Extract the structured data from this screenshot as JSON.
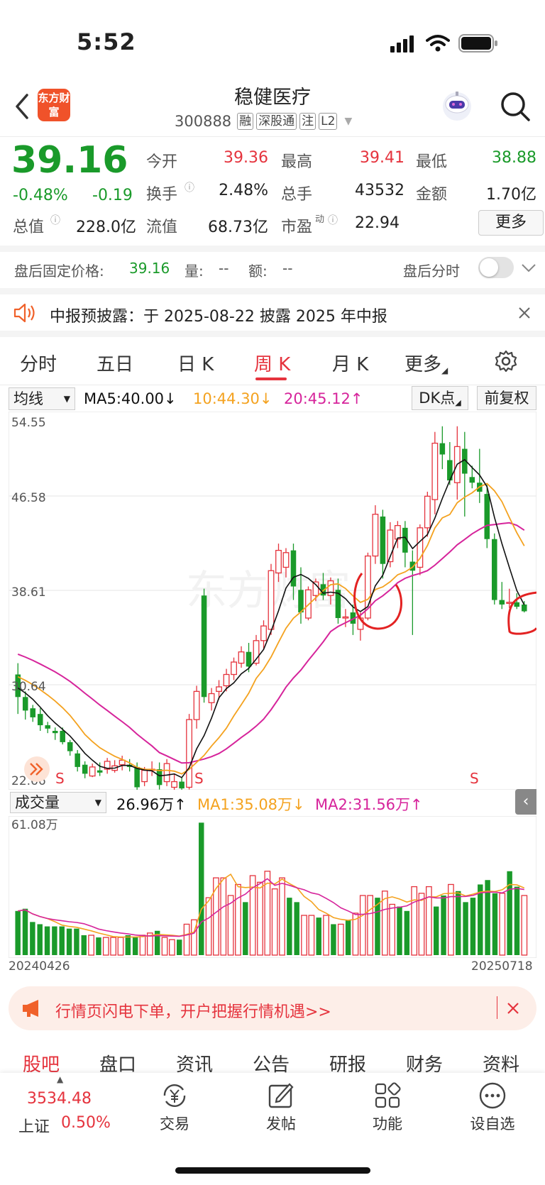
{
  "status_bar": {
    "time": "5:52"
  },
  "header": {
    "logo_text": "东方财富",
    "stock_name": "稳健医疗",
    "stock_code": "300888",
    "tags": [
      "融",
      "深股通",
      "注",
      "L2"
    ]
  },
  "quote": {
    "price": "39.16",
    "change_pct": "-0.48%",
    "change": "-0.19",
    "rows": [
      [
        {
          "label": "今开",
          "value": "39.36",
          "color": "red"
        },
        {
          "label": "最高",
          "value": "39.41",
          "color": "red"
        },
        {
          "label": "最低",
          "value": "38.88",
          "color": "green"
        }
      ],
      [
        {
          "label": "换手",
          "value": "2.48%",
          "color": "black"
        },
        {
          "label": "总手",
          "value": "43532",
          "color": "black"
        },
        {
          "label": "金额",
          "value": "1.70亿",
          "color": "black"
        }
      ],
      [
        {
          "label": "总值",
          "value": "228.0亿",
          "color": "black"
        },
        {
          "label": "流值",
          "value": "68.73亿",
          "color": "black"
        },
        {
          "label": "市盈",
          "value": "22.94",
          "color": "black"
        }
      ]
    ],
    "pe_superscript": "动",
    "more_label": "更多"
  },
  "after_hours": {
    "label": "盘后固定价格:",
    "price": "39.16",
    "vol_label": "量:",
    "vol_value": "--",
    "amt_label": "额:",
    "amt_value": "--",
    "toggle_label": "盘后分时",
    "toggle_on": false
  },
  "notice": {
    "text": "中报预披露：于 2025-08-22 披露 2025 年中报"
  },
  "chart_tabs": [
    {
      "label": "分时",
      "active": false
    },
    {
      "label": "五日",
      "active": false
    },
    {
      "label": "日 K",
      "active": false
    },
    {
      "label": "周 K",
      "active": true
    },
    {
      "label": "月 K",
      "active": false
    },
    {
      "label": "更多",
      "active": false
    }
  ],
  "kline_legend": {
    "selector": "均线",
    "ma5": "MA5:40.00",
    "ma10": "10:44.30",
    "ma20": "20:45.12",
    "dk_button": "DK点",
    "adjust_button": "前复权"
  },
  "volume_legend": {
    "selector": "成交量",
    "vol": "26.96万",
    "ma1": "MA1:35.08万",
    "ma2": "MA2:31.56万"
  },
  "colors": {
    "up": "#e5333d",
    "down": "#1a9a2a",
    "ma5": "#111111",
    "ma10": "#f4a21f",
    "ma20": "#d6249b",
    "accent": "#e5333d"
  },
  "chart_data": [
    {
      "type": "candlestick",
      "title": "",
      "y_ticks": [
        "54.55",
        "46.58",
        "38.61",
        "30.64",
        "22.66"
      ],
      "ylim": [
        22.66,
        54.55
      ],
      "grid": true,
      "signal_markers": [
        "S",
        "S",
        "S"
      ],
      "x_start_label": "20240426",
      "x_end_label": "20250718",
      "series": [
        {
          "name": "ohlc",
          "values": [
            [
              32,
              33,
              28.5,
              30
            ],
            [
              30,
              30.5,
              28,
              28.8
            ],
            [
              29,
              29.3,
              27.8,
              28.2
            ],
            [
              28.5,
              29,
              27,
              27.5
            ],
            [
              27.5,
              27.8,
              26.8,
              27.2
            ],
            [
              27,
              27.3,
              26.2,
              26.8
            ],
            [
              27,
              27.3,
              25.8,
              26
            ],
            [
              26,
              26.2,
              24.8,
              25.2
            ],
            [
              25,
              25.3,
              23.4,
              23.8
            ],
            [
              24,
              24.3,
              22.8,
              23.2
            ],
            [
              23,
              24.1,
              22.9,
              23.8
            ],
            [
              23.5,
              24.2,
              23,
              23.3
            ],
            [
              23.6,
              24.6,
              23.2,
              24.3
            ],
            [
              23.5,
              24.4,
              23.3,
              23.9
            ],
            [
              24,
              24.8,
              23.5,
              24.4
            ],
            [
              24,
              24.5,
              23.4,
              23.8
            ],
            [
              23.8,
              24.2,
              21.5,
              22
            ],
            [
              22.5,
              23.8,
              22.1,
              23.5
            ],
            [
              23.5,
              24.3,
              23,
              23.6
            ],
            [
              23.6,
              24.2,
              21.8,
              22.2
            ],
            [
              22.5,
              24.5,
              22.1,
              24.1
            ],
            [
              22,
              23.2,
              21.2,
              22.5
            ],
            [
              22.5,
              22.9,
              21.6,
              21.9
            ],
            [
              22,
              28.5,
              21.8,
              28
            ],
            [
              28,
              31,
              27.2,
              30.5
            ],
            [
              39,
              39.6,
              29.5,
              30
            ],
            [
              29.5,
              30.8,
              28.8,
              30.3
            ],
            [
              30.5,
              31.5,
              29.8,
              30.9
            ],
            [
              31,
              32.5,
              30.5,
              32
            ],
            [
              32,
              33.5,
              31.5,
              33.1
            ],
            [
              33,
              34.5,
              32.6,
              34
            ],
            [
              34,
              34.8,
              32.2,
              32.7
            ],
            [
              33,
              35.5,
              32.8,
              35
            ],
            [
              35,
              36.8,
              34.2,
              36.3
            ],
            [
              36,
              41.8,
              35.5,
              41.2
            ],
            [
              41,
              43.6,
              40.2,
              43
            ],
            [
              41.5,
              43.2,
              40.6,
              42.8
            ],
            [
              43,
              43.6,
              38.6,
              39.8
            ],
            [
              39.5,
              41.5,
              36.5,
              37.5
            ],
            [
              37,
              39.8,
              36.8,
              39.5
            ],
            [
              39,
              40.5,
              38.5,
              40.2
            ],
            [
              40,
              41,
              38.6,
              39
            ],
            [
              39,
              40.6,
              38.2,
              40.3
            ],
            [
              39.5,
              40.5,
              36.5,
              37
            ],
            [
              37,
              37.8,
              36.2,
              37.1
            ],
            [
              37.5,
              38.2,
              35.5,
              36.5
            ],
            [
              36,
              37.5,
              35,
              37
            ],
            [
              37,
              42.8,
              36.8,
              42.5
            ],
            [
              42.5,
              47,
              41.8,
              46.2
            ],
            [
              46,
              46.6,
              40.5,
              41.8
            ],
            [
              42,
              45.5,
              41.5,
              44.8
            ],
            [
              44,
              45.6,
              43.2,
              45.2
            ],
            [
              45,
              45.6,
              41.5,
              42.8
            ],
            [
              42,
              43,
              35.5,
              41.2
            ],
            [
              41.5,
              45.3,
              40.8,
              45
            ],
            [
              45,
              48.2,
              44.2,
              47.8
            ],
            [
              47.5,
              53.5,
              46.2,
              52.5
            ],
            [
              52.5,
              54,
              50.2,
              51.5
            ],
            [
              51,
              52.6,
              48.8,
              49.2
            ],
            [
              49,
              54,
              47.5,
              52.2
            ],
            [
              52,
              53.5,
              46,
              49.8
            ],
            [
              49.5,
              50.5,
              48.5,
              49
            ],
            [
              49,
              52,
              47.2,
              48.2
            ],
            [
              48,
              48.8,
              43.2,
              44
            ],
            [
              44,
              44.5,
              38.2,
              38.6
            ],
            [
              38.6,
              40.2,
              37.8,
              38.2
            ],
            [
              38.3,
              39.6,
              37.9,
              38.4
            ],
            [
              38.4,
              39.2,
              37.8,
              38
            ],
            [
              38.2,
              38.5,
              37.5,
              37.6
            ]
          ]
        },
        {
          "name": "MA5",
          "values": []
        },
        {
          "name": "MA10",
          "values": []
        },
        {
          "name": "MA20",
          "values": []
        }
      ]
    },
    {
      "type": "bar",
      "title": "",
      "y_max_label": "61.08万",
      "ylim": [
        0,
        61.08
      ],
      "series": [
        {
          "name": "成交量",
          "values": [
            20,
            21,
            15,
            14,
            13,
            13,
            13,
            12,
            12,
            9,
            9,
            8,
            8,
            8,
            8,
            9,
            8,
            9,
            10,
            11,
            8,
            7,
            7,
            14,
            16,
            60,
            26,
            35,
            35,
            27,
            32,
            24,
            36,
            33,
            38,
            30,
            35,
            26,
            24,
            18,
            18,
            17,
            18,
            14,
            14,
            16,
            19,
            27,
            27,
            26,
            29,
            23,
            22,
            20,
            31,
            28,
            31,
            22,
            27,
            32,
            29,
            24,
            26,
            32,
            34,
            28,
            28,
            38,
            31,
            27
          ]
        }
      ]
    }
  ],
  "promo_banner": {
    "text": "行情页闪电下单，开户把握行情机遇>>"
  },
  "bottom_tabs": [
    {
      "label": "股吧",
      "active": true
    },
    {
      "label": "盘口",
      "active": false
    },
    {
      "label": "资讯",
      "active": false
    },
    {
      "label": "公告",
      "active": false
    },
    {
      "label": "研报",
      "active": false
    },
    {
      "label": "财务",
      "active": false
    },
    {
      "label": "资料",
      "active": false
    }
  ],
  "index": {
    "value": "3534.48",
    "name": "上证",
    "pct": "0.50%"
  },
  "bottom_nav": [
    {
      "label": "交易",
      "icon": "yen-exchange-icon"
    },
    {
      "label": "发帖",
      "icon": "edit-icon"
    },
    {
      "label": "功能",
      "icon": "grid-icon"
    },
    {
      "label": "设自选",
      "icon": "more-dots-icon"
    }
  ]
}
